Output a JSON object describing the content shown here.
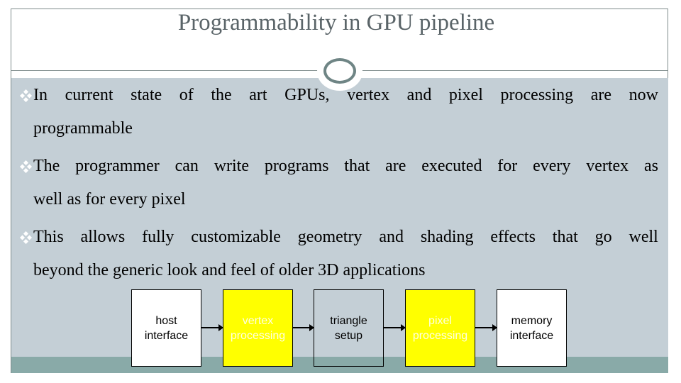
{
  "slide": {
    "title": "Programmability in GPU pipeline",
    "bullets": [
      {
        "first_line_words": [
          "In",
          "current",
          "state",
          "of",
          "the",
          "art",
          "GPUs,",
          "vertex",
          "and",
          "pixel",
          "processing",
          "are",
          "now"
        ],
        "continuation": "programmable"
      },
      {
        "first_line_words": [
          "The",
          "programmer",
          "can",
          "write",
          "programs",
          "that",
          "are",
          "executed",
          "for",
          "every",
          "vertex",
          "as"
        ],
        "continuation": "well as for every pixel"
      },
      {
        "first_line_words": [
          "This",
          "allows",
          "fully",
          "customizable",
          "geometry",
          "and",
          "shading",
          "effects",
          "that",
          "go",
          "well"
        ],
        "continuation": "beyond the generic look and feel of older 3D applications"
      }
    ],
    "bullet_icon": "diamond-bullet-icon"
  },
  "pipeline": {
    "stages": [
      {
        "line1": "host",
        "line2": "interface",
        "fill": "#ffffff",
        "text_color": "#000000"
      },
      {
        "line1": "vertex",
        "line2": "processing",
        "fill": "#ffff00",
        "text_color": "#ffffe0"
      },
      {
        "line1": "triangle",
        "line2": "setup",
        "fill": "transparent",
        "text_color": "#000000"
      },
      {
        "line1": "pixel",
        "line2": "processing",
        "fill": "#ffff00",
        "text_color": "#ffffe0"
      },
      {
        "line1": "memory",
        "line2": "interface",
        "fill": "#ffffff",
        "text_color": "#000000"
      }
    ]
  },
  "colors": {
    "content_bg": "#c4cfd6",
    "bottom_band": "#89aaa8",
    "frame_border": "#7f8c8c",
    "title_text": "#5a6468",
    "highlight_yellow": "#ffff00"
  }
}
